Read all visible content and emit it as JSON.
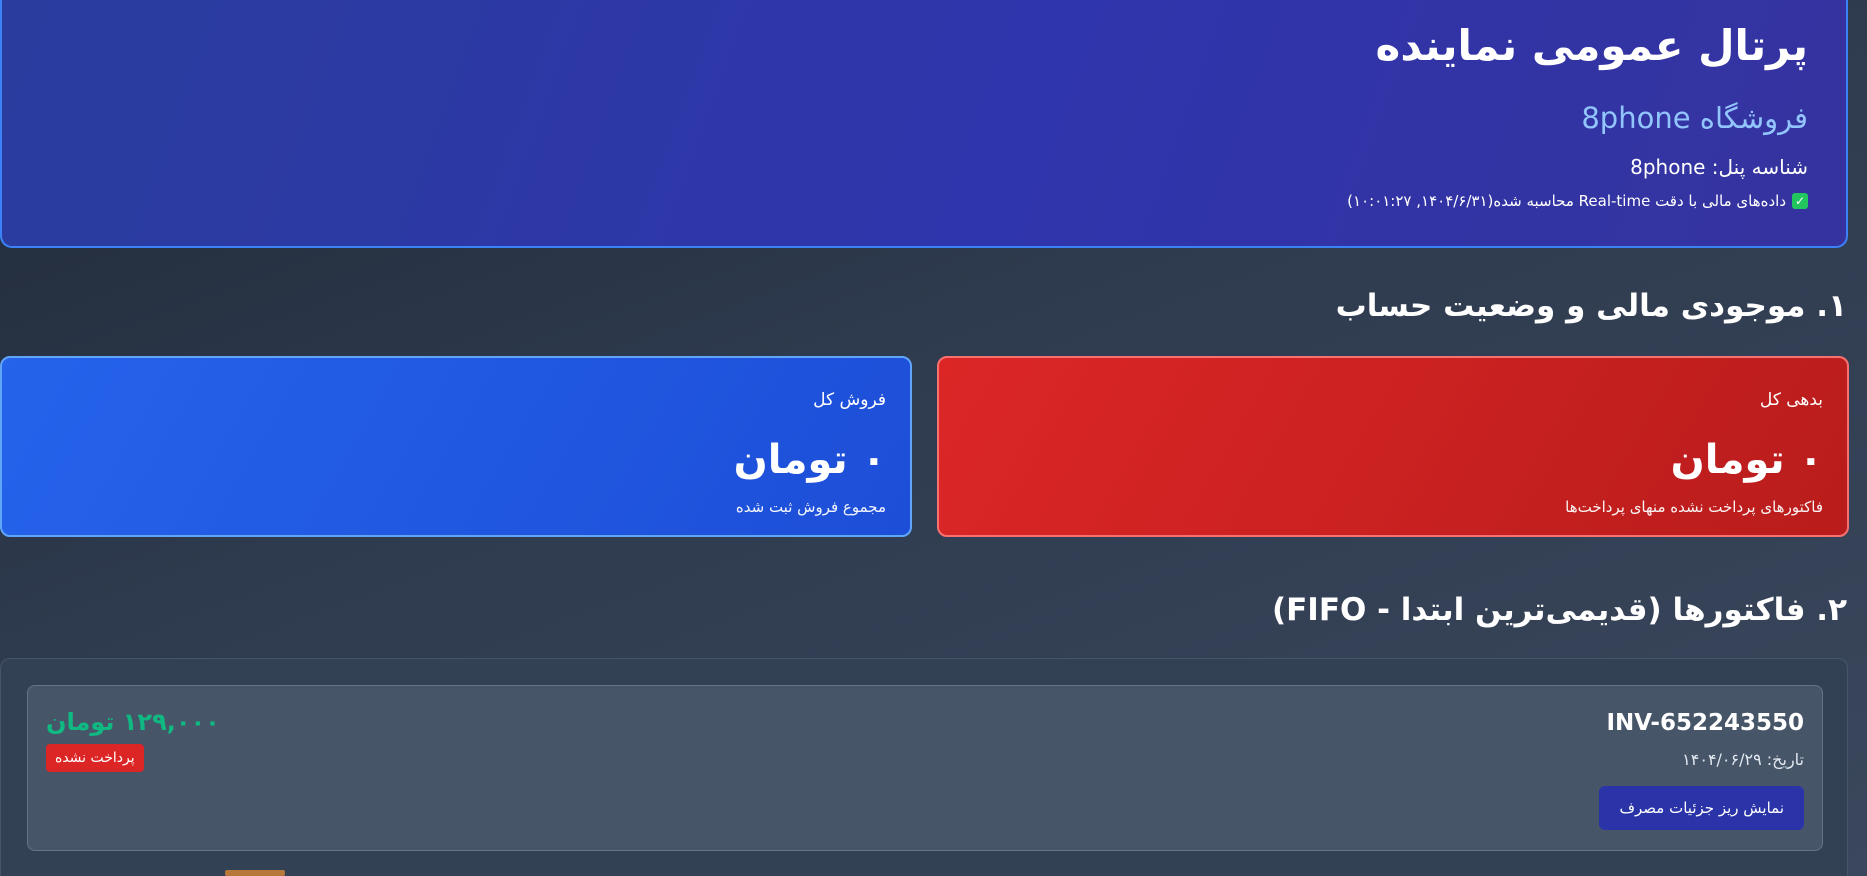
{
  "header": {
    "title": "پرتال عمومی نماینده",
    "store": "فروشگاه 8phone",
    "panel_id": "شناسه پنل: 8phone",
    "status": "داده‌های مالی با دقت Real-time محاسبه شده(۱۴۰۴/۶/۳۱, ۱۰:۰۱:۲۷)"
  },
  "section1": {
    "heading": "۱. موجودی مالی و وضعیت حساب",
    "debt": {
      "label": "بدهی کل",
      "value": "۰ تومان",
      "sub": "فاکتورهای پرداخت نشده منهای پرداخت‌ها"
    },
    "sales": {
      "label": "فروش کل",
      "value": "۰ تومان",
      "sub": "مجموع فروش ثبت شده"
    }
  },
  "section2": {
    "heading": "۲. فاکتورها (قدیمی‌ترین ابتدا - FIFO)",
    "invoice": {
      "number": "INV-652243550",
      "date": "تاریخ: ۱۴۰۴/۰۶/۲۹",
      "detail_button": "نمایش ریز جزئیات مصرف",
      "amount": "۱۲۹,۰۰۰ تومان",
      "status": "پرداخت نشده"
    }
  },
  "colors": {
    "accent": "#3b82f6",
    "debt": "#dc2626",
    "sales": "#2563eb",
    "amount": "#10b981"
  }
}
